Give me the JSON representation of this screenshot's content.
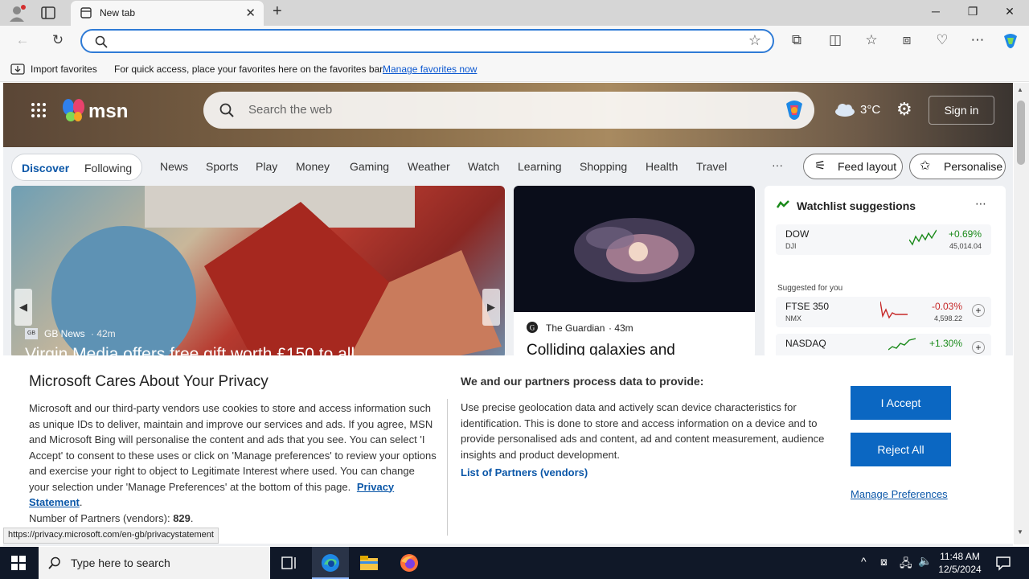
{
  "browser": {
    "tab_title": "New tab",
    "favorites_bar": {
      "import_label": "Import favorites",
      "message": "For quick access, place your favorites here on the favorites bar.",
      "manage_link": "Manage favorites now"
    }
  },
  "msn": {
    "logo_text": "msn",
    "search_placeholder": "Search the web",
    "weather_temp": "3°C",
    "sign_in": "Sign in",
    "nav_tabs": [
      "Discover",
      "Following"
    ],
    "categories": [
      "News",
      "Sports",
      "Play",
      "Money",
      "Gaming",
      "Weather",
      "Watch",
      "Learning",
      "Shopping",
      "Health",
      "Travel"
    ],
    "more_label": "···",
    "feed_layout": "Feed layout",
    "personalise": "Personalise",
    "hero_card": {
      "source": "GB News",
      "age": "· 42m",
      "headline": "Virgin Media offers free gift worth £150 to all"
    },
    "second_card": {
      "source": "The Guardian",
      "age": "· 43m",
      "headline": "Colliding galaxies and"
    },
    "watchlist": {
      "title": "Watchlist suggestions",
      "suggested_label": "Suggested for you",
      "items": [
        {
          "symbol": "DOW",
          "exchange": "DJI",
          "change": "+0.69%",
          "price": "45,014.04",
          "color": "#1a8a1a"
        },
        {
          "symbol": "FTSE 350",
          "exchange": "NMX",
          "change": "-0.03%",
          "price": "4,598.22",
          "color": "#c62828"
        },
        {
          "symbol": "NASDAQ",
          "exchange": "",
          "change": "+1.30%",
          "price": "",
          "color": "#1a8a1a"
        }
      ]
    }
  },
  "privacy": {
    "title": "Microsoft Cares About Your Privacy",
    "body": "Microsoft and our third-party vendors use cookies to store and access information such as unique IDs to deliver, maintain and improve our services and ads. If you agree, MSN and Microsoft Bing will personalise the content and ads that you see. You can select 'I Accept' to consent to these uses or click on 'Manage preferences' to review your options and exercise your right to object to Legitimate Interest where used.  You can change your selection under 'Manage Preferences' at the bottom of this page.",
    "privacy_link": "Privacy Statement",
    "partners_prefix": "Number of Partners (vendors): ",
    "partners_count": "829",
    "right_title": "We and our partners process data to provide:",
    "right_body": "Use precise geolocation data and actively scan device characteristics for identification. This is done to store and access information on a device and to provide personalised ads and content, ad and content measurement, audience insights and product development.",
    "partners_link": "List of Partners (vendors)",
    "accept": "I Accept",
    "reject": "Reject All",
    "manage": "Manage Preferences"
  },
  "status_url": "https://privacy.microsoft.com/en-gb/privacystatement",
  "taskbar": {
    "search_placeholder": "Type here to search",
    "time": "11:48 AM",
    "date": "12/5/2024"
  },
  "colors": {
    "accent": "#0b67c2",
    "link": "#0b57a8"
  }
}
